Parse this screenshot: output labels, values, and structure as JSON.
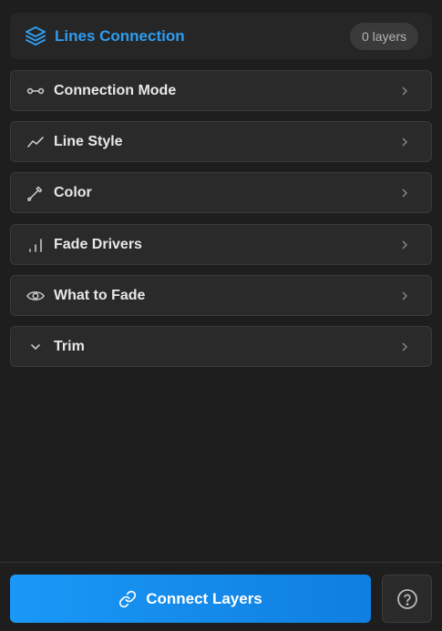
{
  "header": {
    "title": "Lines Connection",
    "layer_count": "0 layers",
    "icon": "layers-icon",
    "accent_color": "#2e9cf0"
  },
  "sections": [
    {
      "label": "Connection Mode",
      "icon": "connection-mode-icon"
    },
    {
      "label": "Line Style",
      "icon": "line-chart-icon"
    },
    {
      "label": "Color",
      "icon": "eyedropper-icon"
    },
    {
      "label": "Fade Drivers",
      "icon": "signal-bars-icon"
    },
    {
      "label": "What to Fade",
      "icon": "eye-icon"
    },
    {
      "label": "Trim",
      "icon": "chevron-down-icon"
    }
  ],
  "footer": {
    "connect_label": "Connect Layers",
    "connect_icon": "link-icon",
    "help_icon": "help-icon",
    "button_color": "#1a98f7"
  }
}
